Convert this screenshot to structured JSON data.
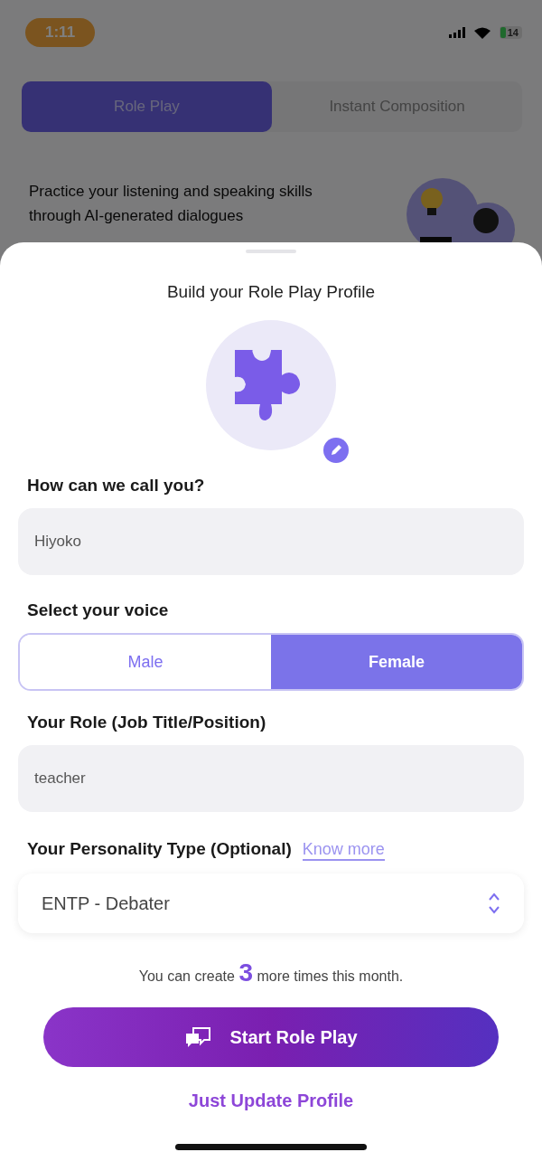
{
  "status_bar": {
    "time": "1:11",
    "battery": "14"
  },
  "tabs": [
    {
      "label": "Role Play",
      "selected": true
    },
    {
      "label": "Instant Composition",
      "selected": false
    }
  ],
  "description": "Practice your listening and speaking skills through AI-generated dialogues",
  "sheet": {
    "title": "Build your Role Play Profile",
    "name_label": "How can we call you?",
    "name_value": "Hiyoko",
    "voice_label": "Select your voice",
    "voices": [
      {
        "label": "Male",
        "selected": false
      },
      {
        "label": "Female",
        "selected": true
      }
    ],
    "role_label": "Your Role (Job Title/Position)",
    "role_value": "teacher",
    "personality_label": "Your Personality Type (Optional)",
    "know_more": "Know more",
    "personality_value": "ENTP - Debater",
    "quota": {
      "prefix": "You can create",
      "count": "3",
      "suffix": "more times this month."
    },
    "primary_button": "Start Role Play",
    "secondary_link": "Just Update Profile"
  }
}
